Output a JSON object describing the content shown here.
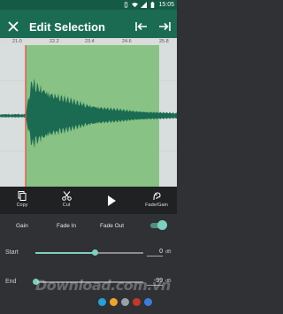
{
  "status_bar": {
    "time": "15:05",
    "icons": [
      "vibrate-icon",
      "wifi-icon",
      "signal-icon",
      "battery-icon"
    ]
  },
  "app_bar": {
    "title": "Edit Selection",
    "close_icon": "close-icon",
    "nav_icons": [
      "skip-to-start-icon",
      "skip-to-end-icon"
    ]
  },
  "ruler": {
    "ticks": [
      "21.0",
      "22.2",
      "23.4",
      "24.6",
      "25.8"
    ]
  },
  "waveform": {
    "selection_color": "#7fbf7a",
    "wave_color": "#1a6b52",
    "playhead_color": "#e05a4a"
  },
  "toolbar": {
    "copy_label": "Copy",
    "cut_label": "Cut",
    "play_icon": "play-icon",
    "fade_gain_label": "Fade/Gain"
  },
  "modes": {
    "gain": "Gain",
    "fade_in": "Fade In",
    "fade_out": "Fade Out",
    "toggle_on": true
  },
  "start": {
    "label": "Start",
    "value": "0",
    "unit": "dB",
    "level": 0.55
  },
  "end": {
    "label": "End",
    "value": "-99",
    "unit": "dB",
    "level": 0.0
  },
  "watermark": {
    "text": "Download.com.vn"
  },
  "colors": {
    "accent": "#7dd0bf",
    "appbar": "#1a6b52",
    "statusbar": "#155a45"
  },
  "footer_dots": [
    "#2a9fd6",
    "#f0a32c",
    "#9aa0a6",
    "#c0392b",
    "#3b7dd8"
  ]
}
